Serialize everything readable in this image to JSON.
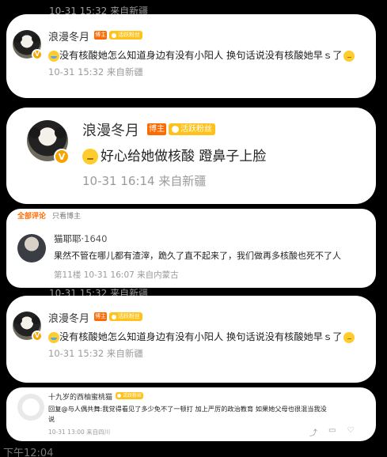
{
  "ghost_text": "10-31 15:32 来自新疆",
  "card1": {
    "name": "浪漫冬月",
    "badge_blogger": "博主",
    "badge_fan": "活跃粉丝",
    "verified": "V",
    "text": "没有核酸她怎么知道身边有没有小阳人 换句话说没有核酸她早ｓ了",
    "meta": "10-31 15:32 来自新疆",
    "emoji_lead": "cry-icon",
    "emoji_tail": "thinking-icon"
  },
  "card2": {
    "name": "浪漫冬月",
    "badge_blogger": "博主",
    "badge_fan": "活跃粉丝",
    "verified": "V",
    "text": "好心给她做核酸 蹬鼻子上脸",
    "meta": "10-31 16:14 来自新疆",
    "emoji_lead": "thinking-icon"
  },
  "card3": {
    "tabs": [
      "全部评论",
      "只看博主"
    ],
    "name": "猫耶耶",
    "level": "·1640",
    "text": "果然不管在哪儿都有渣滓，跪久了直不起来了，我们做再多核酸也死不了人",
    "meta": "第11楼 10-31 16:07 来自内蒙古"
  },
  "card4": {
    "name": "浪漫冬月",
    "badge_blogger": "博主",
    "badge_fan": "活跃粉丝",
    "verified": "V",
    "text": "没有核酸她怎么知道身边有没有小阳人 换句话说没有核酸她早ｓ了",
    "meta": "10-31 15:32 来自新疆",
    "emoji_lead": "cry-icon",
    "emoji_tail": "thinking-icon"
  },
  "card5": {
    "name": "十九岁的西柚蜜桃猫",
    "badge_fan": "活跃粉丝",
    "text_line1": "回复@与人偶共舞:我觉得看见了多少免不了一顿打 加上严厉的政治教育 如果她父母也很混当我没",
    "text_line2": "说",
    "meta": "10-31 13:00 来自四川"
  },
  "status_time": "下午12:04"
}
